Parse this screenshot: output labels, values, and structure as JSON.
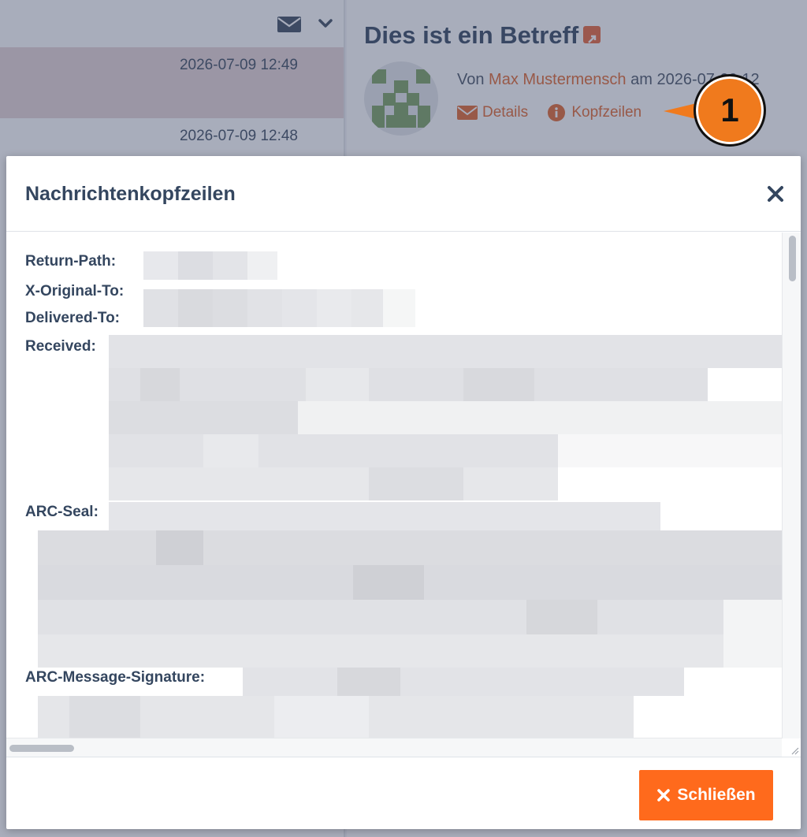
{
  "mail_list": {
    "rows": [
      {
        "date": "2026-07-09 12:49",
        "selected": true
      },
      {
        "date": "2026-07-09 12:48",
        "selected": false
      }
    ]
  },
  "message": {
    "subject": "Dies ist ein Betreff",
    "from_prefix": "Von ",
    "sender": "Max Mustermensch",
    "date_prefix": " am ",
    "date": "2026-07-09 12",
    "details_label": "Details",
    "headers_label": "Kopfzeilen"
  },
  "callout": {
    "number": "1"
  },
  "modal": {
    "title": "Nachrichtenkopfzeilen",
    "header_keys": [
      "Return-Path:",
      "X-Original-To:",
      "Delivered-To:",
      "Received:",
      "ARC-Seal:",
      "ARC-Message-Signature:"
    ],
    "close_button_label": "Schließen"
  },
  "colors": {
    "accent": "#e2662e",
    "button": "#ff6a1c",
    "callout": "#f07a1d",
    "title_text": "#34465f"
  },
  "icons": {
    "toolbar": [
      "envelope-icon",
      "chevron-down-icon"
    ],
    "links": [
      "envelope-icon",
      "info-icon"
    ],
    "modal": [
      "close-icon",
      "x-icon"
    ]
  }
}
